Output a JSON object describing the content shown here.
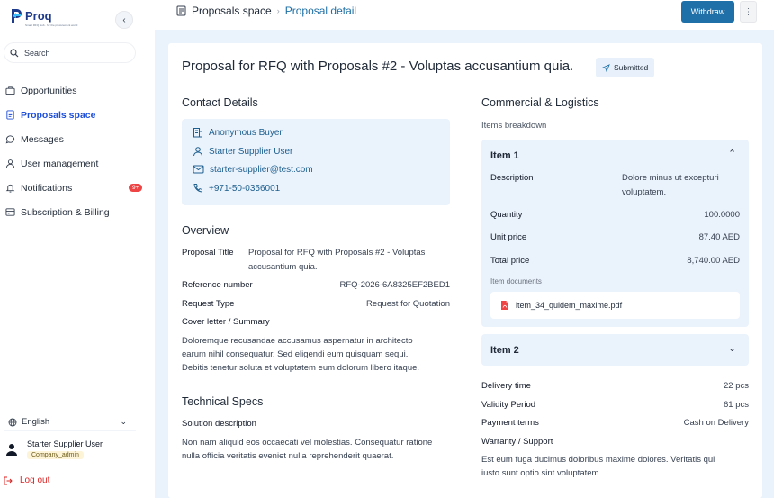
{
  "brand": {
    "name": "Proq",
    "tagline": "Smart RFQ Hub · for the procurement world"
  },
  "sidebar": {
    "search_placeholder": "Search",
    "items": [
      {
        "label": "Opportunities",
        "icon": "briefcase-icon"
      },
      {
        "label": "Proposals space",
        "icon": "document-icon",
        "active": true
      },
      {
        "label": "Messages",
        "icon": "chat-icon"
      },
      {
        "label": "User management",
        "icon": "user-icon"
      },
      {
        "label": "Notifications",
        "icon": "bell-icon",
        "badge": "9+"
      },
      {
        "label": "Subscription & Billing",
        "icon": "billing-icon"
      }
    ],
    "language": "English",
    "user": {
      "name": "Starter Supplier User",
      "role": "Company_admin"
    },
    "logout": "Log out"
  },
  "topbar": {
    "breadcrumb_root": "Proposals space",
    "breadcrumb_current": "Proposal detail",
    "withdraw_label": "Withdraw"
  },
  "proposal": {
    "title": "Proposal for RFQ with Proposals #2 - Voluptas accusantium quia.",
    "status": "Submitted",
    "status_color": "#e8f1fb"
  },
  "contact": {
    "heading": "Contact Details",
    "buyer": "Anonymous Buyer",
    "supplier": "Starter Supplier User",
    "email": "starter-supplier@test.com",
    "phone": "+971-50-0356001"
  },
  "overview": {
    "heading": "Overview",
    "proposal_title_label": "Proposal Title",
    "proposal_title_line1": "Proposal for RFQ with Proposals #2 - Voluptas",
    "proposal_title_line2": "accusantium quia.",
    "reference_label": "Reference number",
    "reference_value": "RFQ-2026-6A8325EF2BED1",
    "request_type_label": "Request Type",
    "request_type_value": "Request for Quotation",
    "cover_label": "Cover letter / Summary",
    "cover_line1": "Doloremque recusandae accusamus aspernatur in architecto",
    "cover_line2": "earum nihil consequatur. Sed eligendi eum quisquam sequi.",
    "cover_line3": "Debitis tenetur soluta et voluptatem eum dolorum libero itaque."
  },
  "technical": {
    "heading": "Technical Specs",
    "solution_label": "Solution description",
    "solution_line1": "Non nam aliquid eos occaecati vel molestias. Consequatur ratione",
    "solution_line2": "nulla officia veritatis eveniet nulla reprehenderit quaerat."
  },
  "commercial": {
    "heading": "Commercial & Logistics",
    "breakdown_label": "Items breakdown",
    "item1": {
      "title": "Item 1",
      "description_label": "Description",
      "description_line1": "Dolore minus ut excepturi",
      "description_line2": "voluptatem.",
      "quantity_label": "Quantity",
      "quantity_value": "100.0000",
      "unit_price_label": "Unit price",
      "unit_price_value": "87.40 AED",
      "total_price_label": "Total price",
      "total_price_value": "8,740.00 AED",
      "documents_label": "Item documents",
      "document_name": "item_34_quidem_maxime.pdf"
    },
    "item2": {
      "title": "Item 2"
    },
    "delivery_label": "Delivery time",
    "delivery_value": "22 pcs",
    "validity_label": "Validity Period",
    "validity_value": "61 pcs",
    "payment_label": "Payment terms",
    "payment_value": "Cash on Delivery",
    "warranty_label": "Warranty / Support",
    "warranty_line1": "Est eum fuga ducimus doloribus maxime dolores. Veritatis qui",
    "warranty_line2": "iusto sunt optio sint voluptatem."
  },
  "colors": {
    "accent": "#1f6fa8",
    "panel": "#eaf2fb",
    "danger": "#dc2626"
  }
}
